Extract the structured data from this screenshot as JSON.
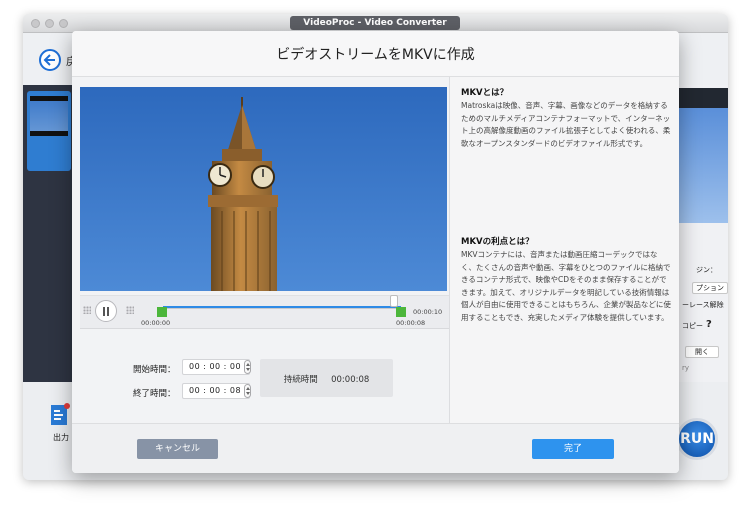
{
  "app": {
    "window_title": "VideoProc - Video Converter",
    "back_label": "戻",
    "output_label": "出力",
    "run_label": "RUN",
    "right_panel": {
      "option_suffix": "ジン：",
      "option_button": "プション",
      "deinterlace": "ーレース解除",
      "copy_label": "コピー",
      "help_icon_text": "?",
      "open_button": "開く",
      "path_fragment": "ry"
    }
  },
  "modal": {
    "title": "ビデオストリームをMKVに作成",
    "timeline": {
      "start_time": "00:00:00",
      "end_time": "00:00:08",
      "total_time": "00:00:10"
    },
    "form": {
      "start_label": "開始時間：",
      "start_value": "00 : 00 : 00",
      "end_label": "終了時間：",
      "end_value": "00 : 00 : 08",
      "duration_label": "持続時間",
      "duration_value": "00:00:08"
    },
    "info": {
      "heading1": "MKVとは？",
      "body1": "Matroskaは映像、音声、字幕、画像などのデータを格納するためのマルチメディアコンテナフォーマットで、インターネット上の高解像度動画のファイル拡張子としてよく使われる、柔軟なオープンスタンダードのビデオファイル形式です。",
      "heading2": "MKVの利点とは？",
      "body2": "MKVコンテナには、音声または動画圧縮コーデックではなく、たくさんの音声や動画、字幕をひとつのファイルに格納できるコンテナ形式で、映像やCDをそのまま保存することができます。加えて、オリジナルデータを明記している技術情報は個人が自由に使用できることはもちろん、企業が製品などに使用することもでき、充実したメディア体験を提供しています。"
    },
    "footer": {
      "cancel_label": "キャンセル",
      "done_label": "完了"
    }
  },
  "colors": {
    "accent": "#2e93ee",
    "trim_handle": "#4cb63b",
    "cancel": "#8793a6"
  }
}
